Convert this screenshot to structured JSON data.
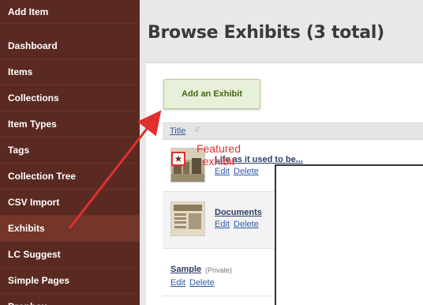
{
  "sidebar": {
    "items": [
      {
        "label": "Add Item"
      },
      {
        "label": "Dashboard"
      },
      {
        "label": "Items"
      },
      {
        "label": "Collections"
      },
      {
        "label": "Item Types"
      },
      {
        "label": "Tags"
      },
      {
        "label": "Collection Tree"
      },
      {
        "label": "CSV Import"
      },
      {
        "label": "Exhibits",
        "active": true
      },
      {
        "label": "LC Suggest"
      },
      {
        "label": "Simple Pages"
      },
      {
        "label": "Dropbox"
      }
    ]
  },
  "main": {
    "title": "Browse Exhibits (3 total)",
    "add_button": "Add an Exhibit",
    "table": {
      "column_title": "Title",
      "rows": [
        {
          "title": "Life as it used to be...",
          "featured": true,
          "edit": "Edit",
          "delete": "Delete",
          "thumbnail": "old-street-photo"
        },
        {
          "title": "Documents",
          "edit": "Edit",
          "delete": "Delete",
          "thumbnail": "newspaper-heavy-losses"
        },
        {
          "title": "Sample",
          "status": "(Private)",
          "edit": "Edit",
          "delete": "Delete"
        }
      ]
    }
  },
  "annotation": {
    "text_line1": "Featured",
    "text_line2": "exhibit",
    "color": "#e03030"
  },
  "colors": {
    "sidebar": "#5a2a22",
    "add_button_bg": "#e7f0d8",
    "link": "#2e5ca8",
    "annotation": "#e03030"
  },
  "icons": {
    "featured": "star-icon",
    "sort": "sort-icon"
  }
}
